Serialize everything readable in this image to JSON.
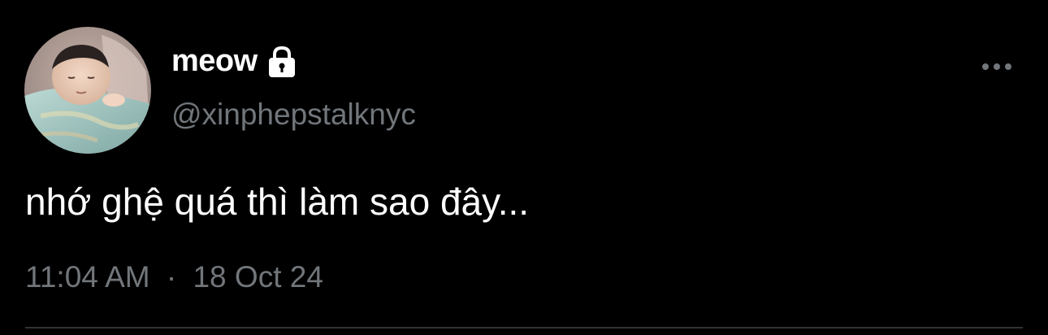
{
  "tweet": {
    "display_name": "meow",
    "handle": "@xinphepstalknyc",
    "text": "nhớ ghệ quá thì làm sao đây...",
    "time": "11:04 AM",
    "separator": "·",
    "date": "18 Oct 24",
    "account_protected": true
  },
  "icons": {
    "lock": "lock-icon",
    "more": "more-options-icon"
  },
  "colors": {
    "background": "#000000",
    "primary_text": "#ffffff",
    "secondary_text": "#71767b",
    "divider": "#2f3336"
  }
}
